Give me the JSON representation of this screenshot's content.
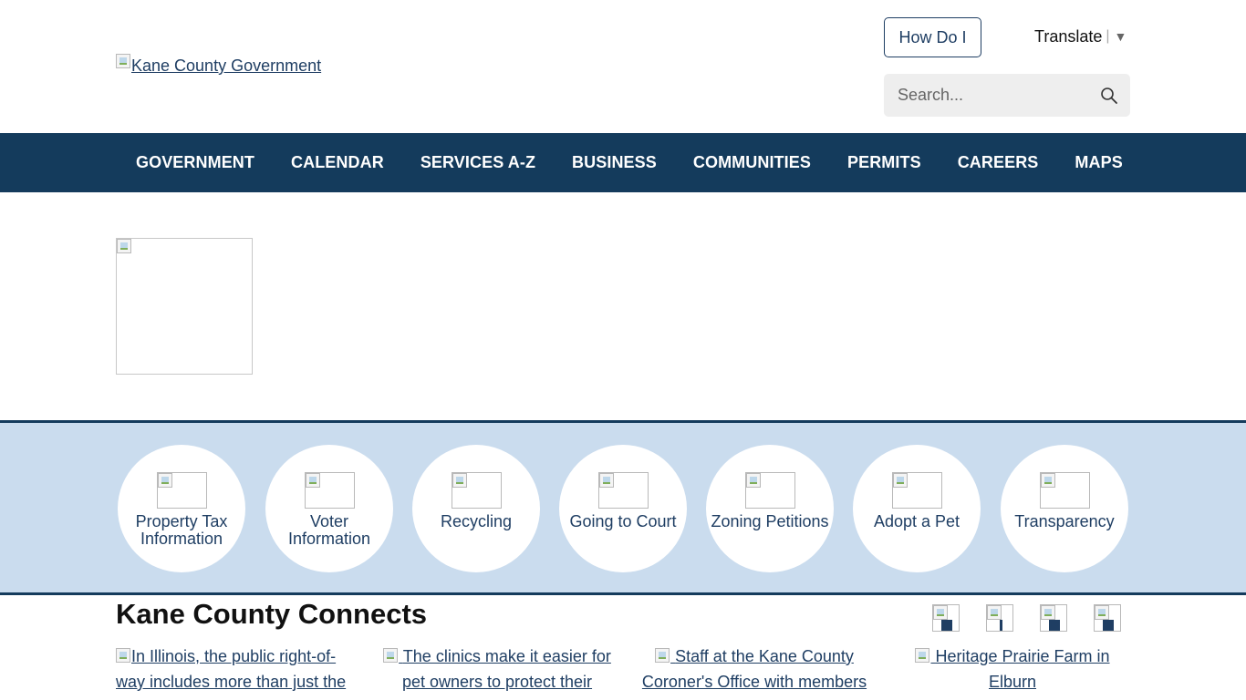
{
  "header": {
    "logo_alt": "Kane County Government",
    "how_do_i": "How Do I",
    "translate": {
      "label": "Translate",
      "separator": "|",
      "caret": "▼"
    },
    "search": {
      "placeholder": "Search..."
    }
  },
  "nav": {
    "items": [
      "GOVERNMENT",
      "CALENDAR",
      "SERVICES A-Z",
      "BUSINESS",
      "COMMUNITIES",
      "PERMITS",
      "CAREERS",
      "MAPS"
    ]
  },
  "quick_links": [
    "Property Tax Information",
    "Voter Information",
    "Recycling",
    "Going to Court",
    "Zoning Petitions",
    "Adopt a Pet",
    "Transparency"
  ],
  "connects": {
    "title": "Kane County Connects",
    "social_icons": [
      "facebook-icon",
      "instagram-icon",
      "youtube-icon",
      "twitter-icon"
    ],
    "news": [
      "In Illinois, the public right-of-way includes more than just the",
      "The clinics make it easier for pet owners to protect their",
      "Staff at the Kane County Coroner's Office with members",
      "Heritage Prairie Farm in Elburn"
    ]
  },
  "colors": {
    "nav_bg": "#143b5c",
    "band_bg": "#cadcee",
    "link": "#1f3e63"
  }
}
